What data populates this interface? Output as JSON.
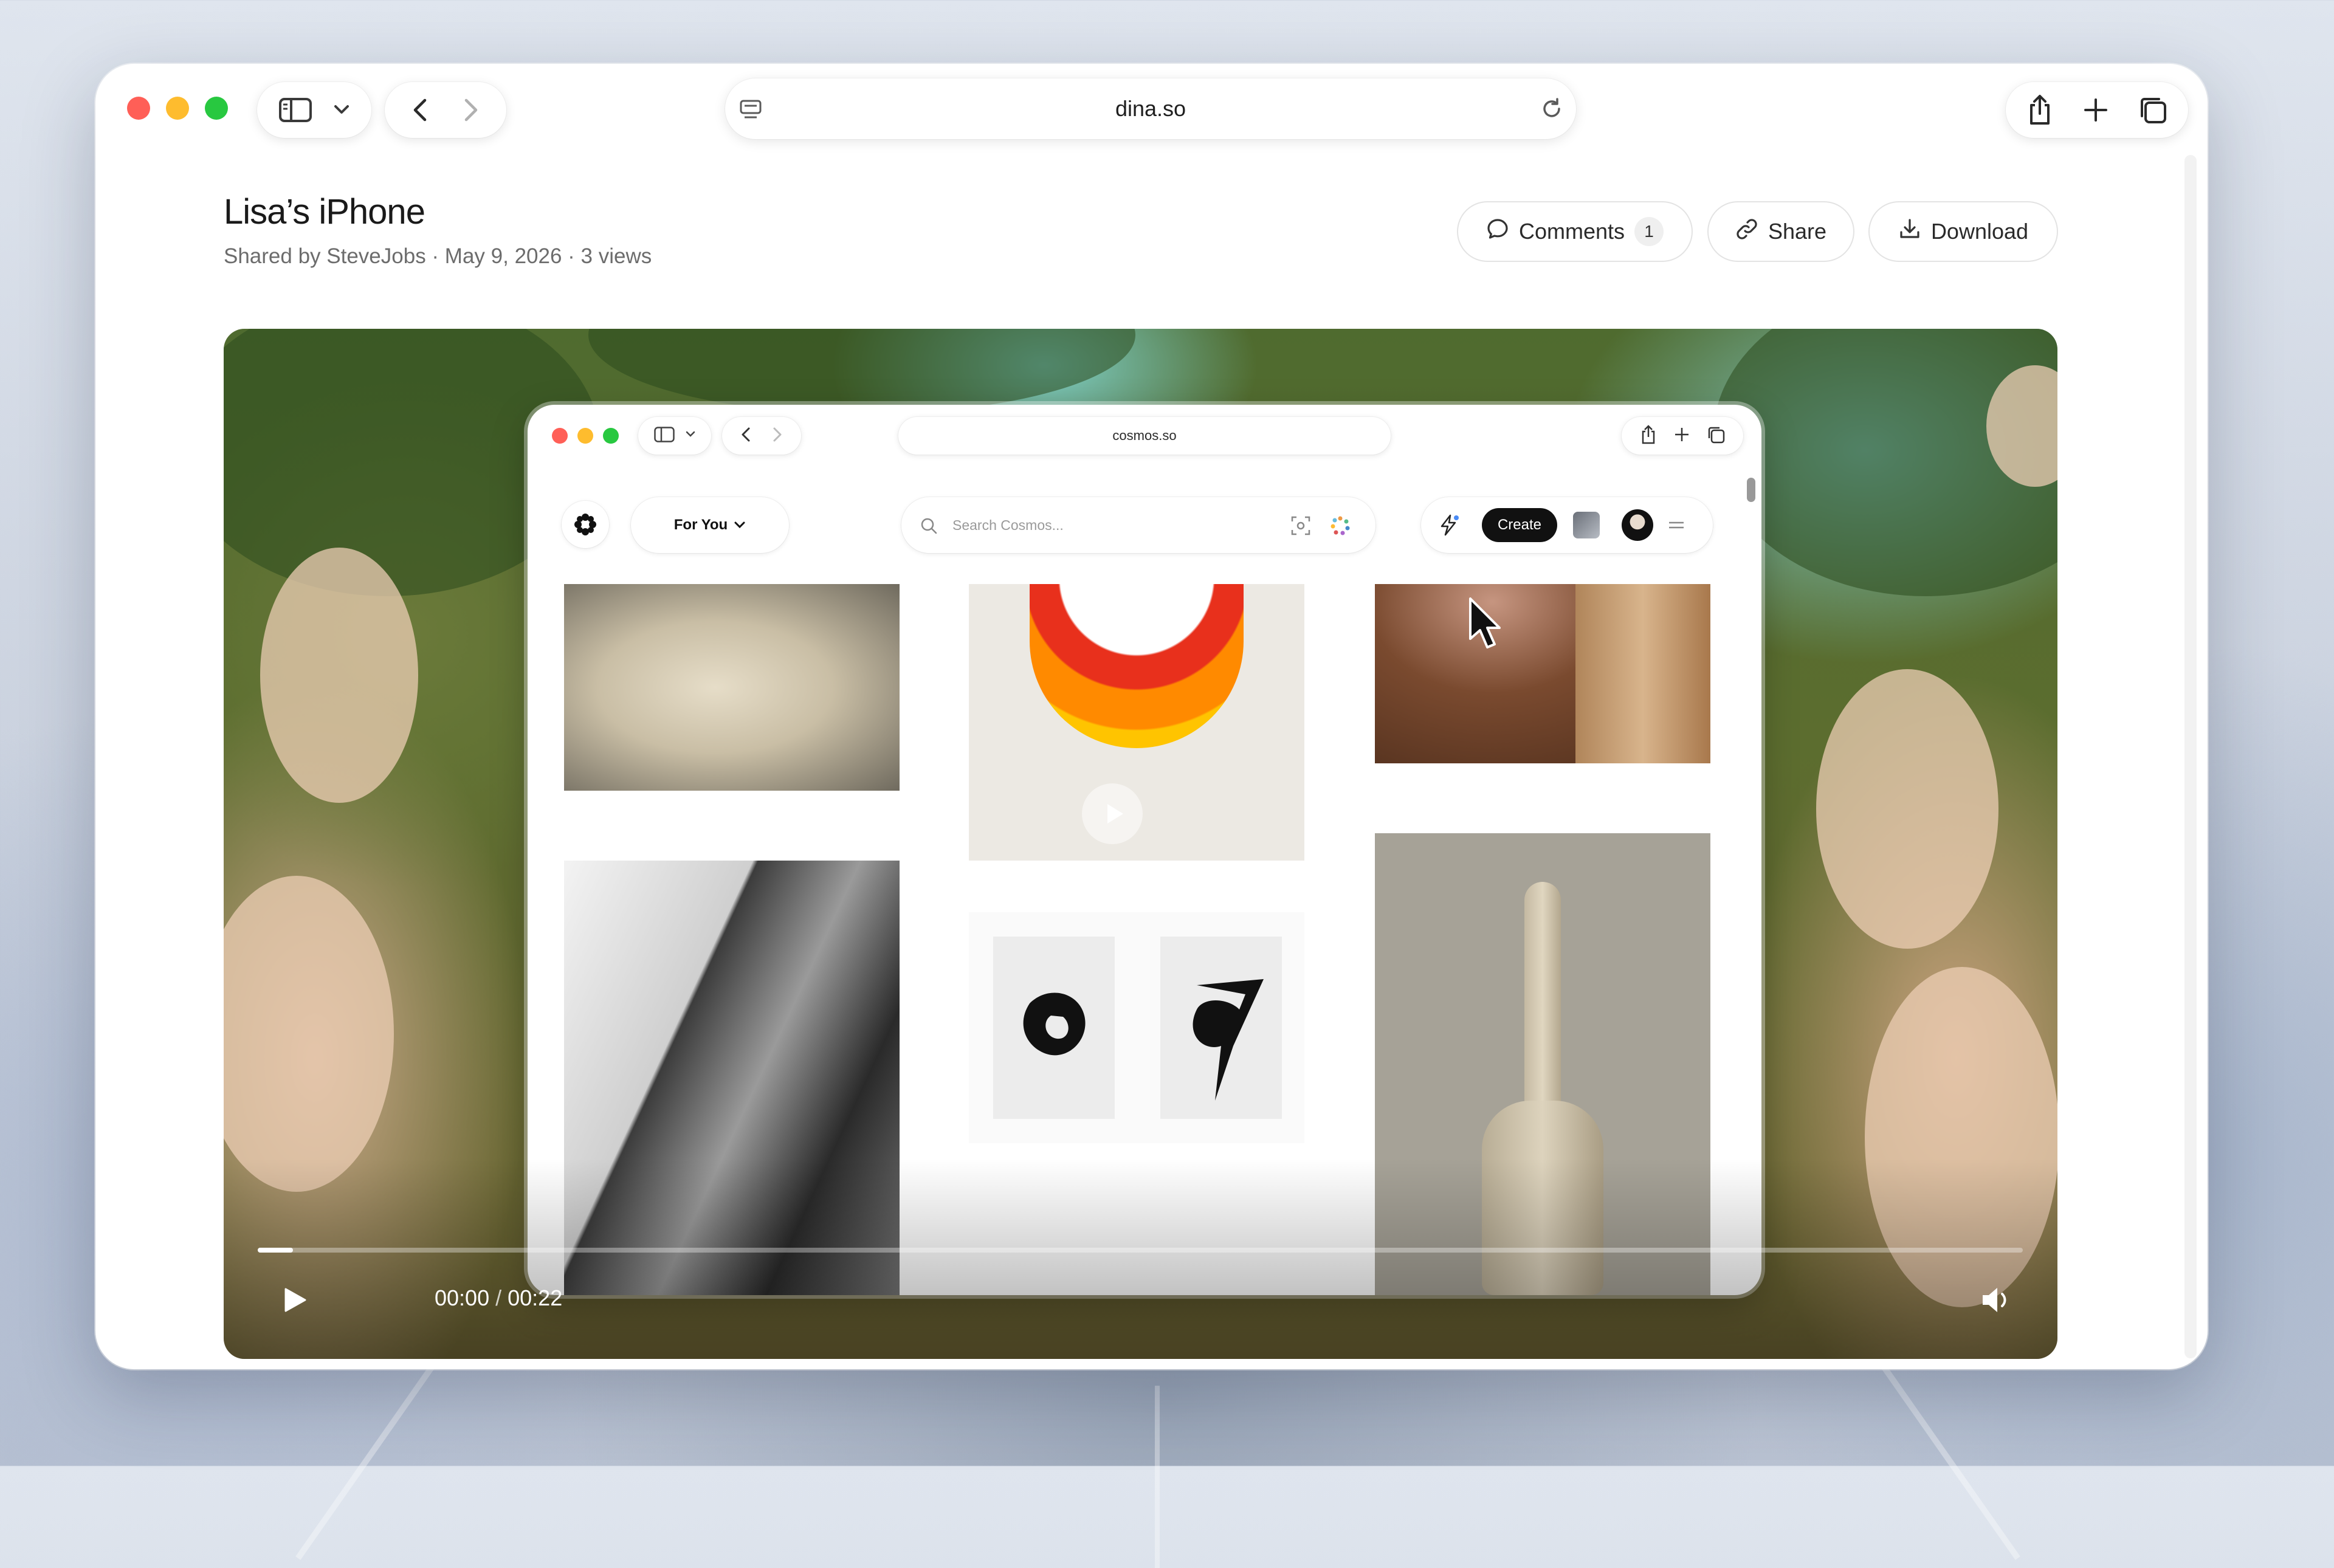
{
  "browser": {
    "url": "dina.so",
    "traffic_colors": [
      "#ff5f57",
      "#febc2e",
      "#28c840"
    ]
  },
  "page": {
    "title": "Lisa’s iPhone",
    "meta": "Shared by SteveJobs · May 9, 2026 · 3 views",
    "comments_label": "Comments",
    "comments_count": "1",
    "share_label": "Share",
    "download_label": "Download"
  },
  "video": {
    "current_time": "00:00",
    "duration": "00:22",
    "time_separator": "/",
    "progress_fraction": 0.02,
    "inner": {
      "url": "cosmos.so",
      "for_you_label": "For You",
      "search_placeholder": "Search Cosmos...",
      "create_label": "Create"
    }
  },
  "icons": {
    "sidebar": "sidebar-icon",
    "back": "chevron-left-icon",
    "forward": "chevron-right-icon",
    "share": "share-icon",
    "new_tab": "plus-icon",
    "tabs": "tabs-icon",
    "play": "play-icon",
    "volume": "volume-icon",
    "fullscreen": "fullscreen-icon"
  }
}
